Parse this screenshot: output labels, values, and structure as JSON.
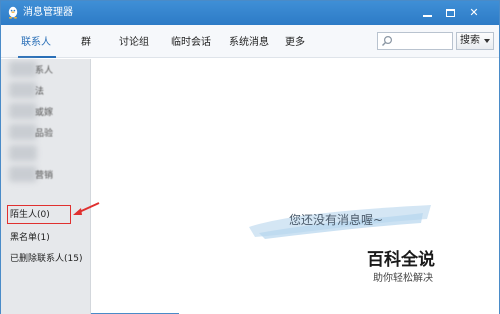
{
  "window": {
    "title": "消息管理器"
  },
  "tabs": [
    {
      "label": "联系人",
      "active": true
    },
    {
      "label": "群"
    },
    {
      "label": "讨论组"
    },
    {
      "label": "临时会话"
    },
    {
      "label": "系统消息"
    },
    {
      "label": "更多"
    }
  ],
  "search": {
    "value": "",
    "button_label": "搜索"
  },
  "sidebar": {
    "blurred_items": [
      "系人",
      "法",
      "或嫁",
      "品验",
      "",
      "营销"
    ],
    "items": [
      {
        "label": "陌生人(0)",
        "highlighted": true
      },
      {
        "label": "黑名单(1)"
      },
      {
        "label": "已删除联系人(15)"
      }
    ]
  },
  "content": {
    "empty_message": "您还没有消息喔~"
  },
  "watermark": {
    "title": "百科全说",
    "subtitle": "助你轻松解决"
  },
  "colors": {
    "titlebar": "#2d7bc6",
    "accent": "#2a6fb7",
    "highlight": "#e0302f"
  }
}
